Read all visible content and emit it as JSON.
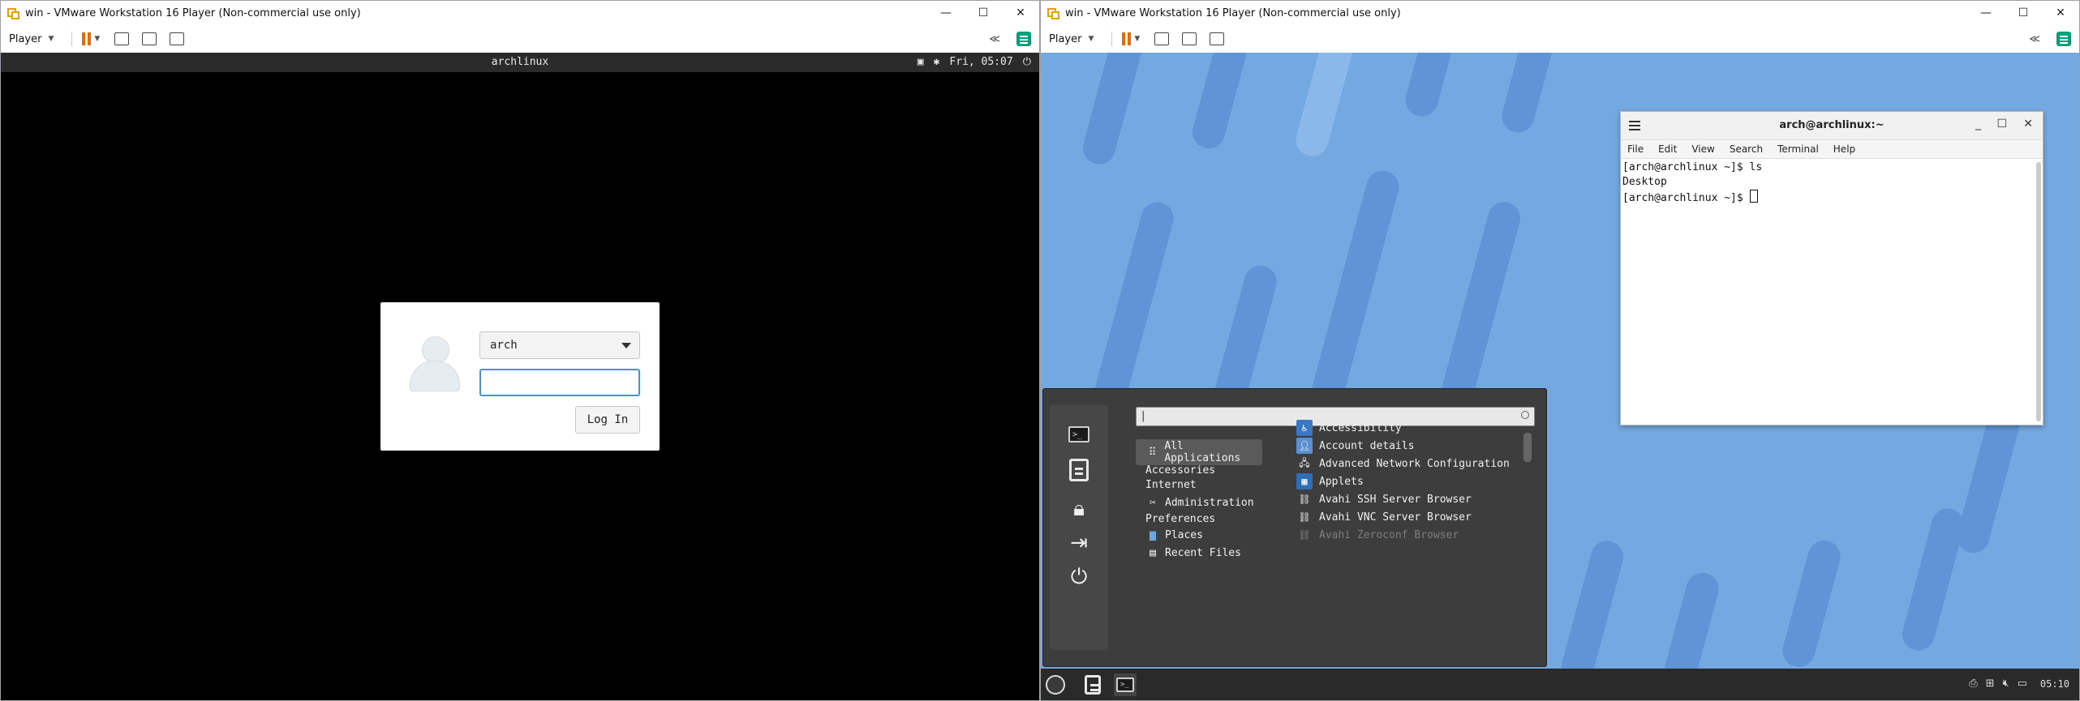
{
  "left_window": {
    "title": "win - VMware Workstation 16 Player (Non-commercial use only)",
    "toolbar": {
      "player_label": "Player",
      "collapse_glyph": "≪"
    },
    "vm": {
      "hostname": "archlinux",
      "clock": "Fri, 05:07",
      "login": {
        "username": "arch",
        "password_value": "",
        "login_button": "Log In"
      }
    }
  },
  "right_window": {
    "title": "win - VMware Workstation 16 Player (Non-commercial use only)",
    "toolbar": {
      "player_label": "Player",
      "collapse_glyph": "≪"
    },
    "terminal": {
      "title": "arch@archlinux:~",
      "menu": [
        "File",
        "Edit",
        "View",
        "Search",
        "Terminal",
        "Help"
      ],
      "lines": [
        "[arch@archlinux ~]$ ls",
        "Desktop",
        "[arch@archlinux ~]$ "
      ]
    },
    "app_menu": {
      "search_value": "",
      "categories": [
        {
          "label": "All Applications",
          "icon": "grid-icon"
        },
        {
          "label": "Accessories",
          "icon": ""
        },
        {
          "label": "Internet",
          "icon": ""
        },
        {
          "label": "Administration",
          "icon": "tools-icon"
        },
        {
          "label": "Preferences",
          "icon": ""
        },
        {
          "label": "Places",
          "icon": "folder-icon"
        },
        {
          "label": "Recent Files",
          "icon": "document-icon"
        }
      ],
      "applications": [
        {
          "label": "Accessibility",
          "icon": "accessibility-icon"
        },
        {
          "label": "Account details",
          "icon": "account-icon"
        },
        {
          "label": "Advanced Network Configuration",
          "icon": "network-icon"
        },
        {
          "label": "Applets",
          "icon": "applets-icon"
        },
        {
          "label": "Avahi SSH Server Browser",
          "icon": "avahi-icon"
        },
        {
          "label": "Avahi VNC Server Browser",
          "icon": "avahi-icon"
        },
        {
          "label": "Avahi Zeroconf Browser",
          "icon": "avahi-icon"
        }
      ]
    },
    "panel": {
      "clock": "05:10"
    }
  },
  "colors": {
    "desktop_bg": "#74a8e0",
    "login_focus": "#4a90d9",
    "menu_bg": "#3d3d3d",
    "pause_orange": "#e66b00"
  }
}
